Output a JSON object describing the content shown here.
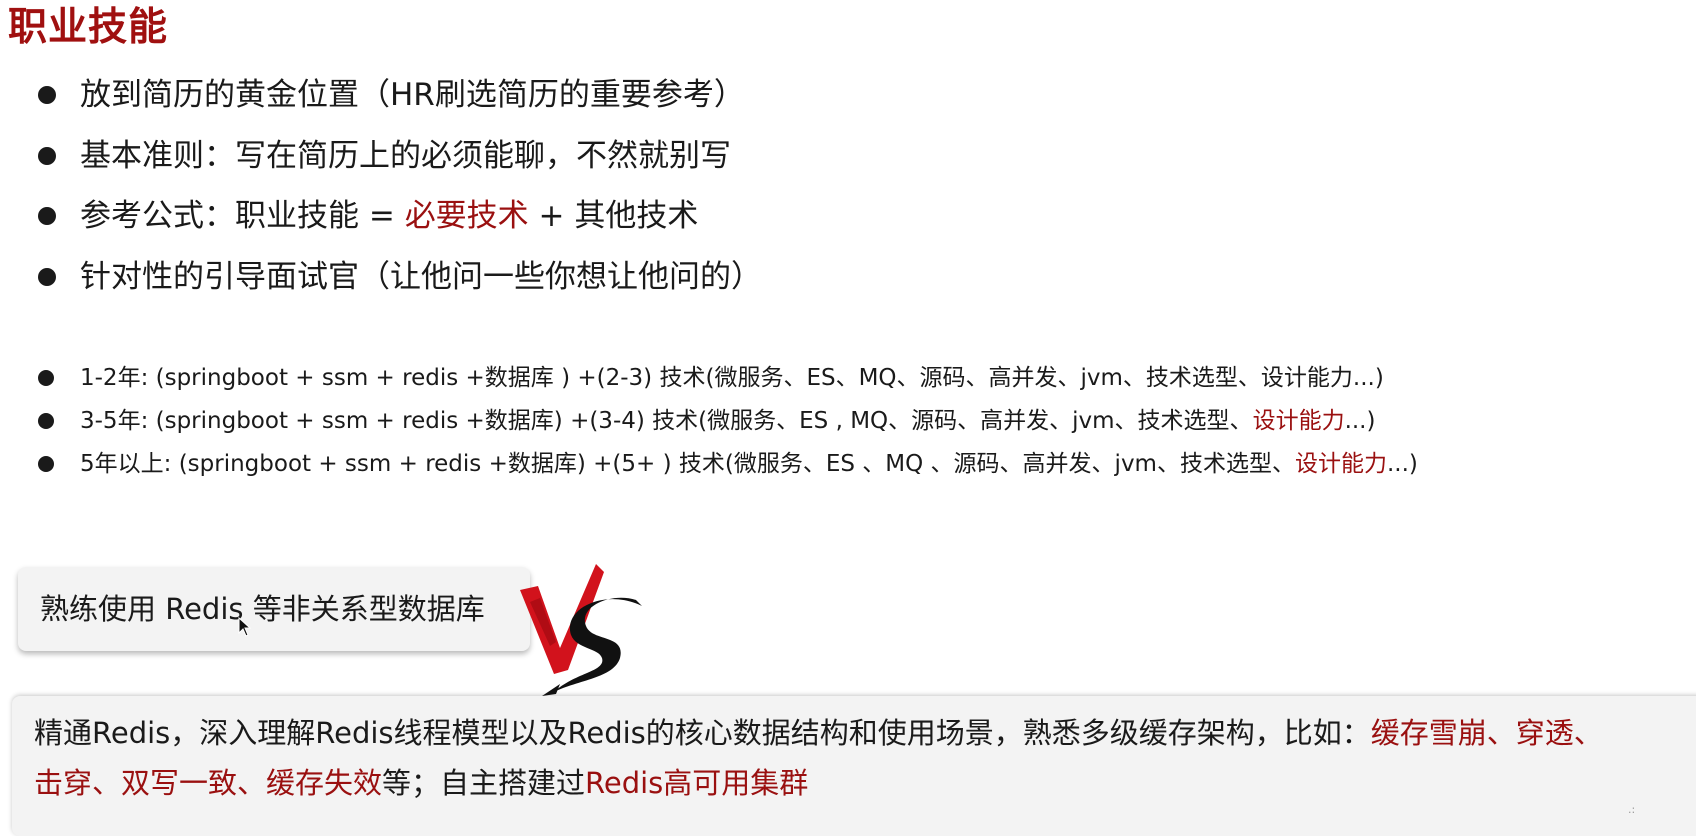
{
  "title": "职业技能",
  "bullets": [
    {
      "text": "放到简历的黄金位置（HR刷选简历的重要参考）"
    },
    {
      "text": "基本准则：写在简历上的必须能聊，不然就别写"
    },
    {
      "pre": "参考公式：职业技能 = ",
      "red": "必要技术",
      "post": " + 其他技术"
    },
    {
      "text": "针对性的引导面试官（让他问一些你想让他问的）"
    }
  ],
  "levels": [
    {
      "pre": "1-2年: (springboot + ssm + redis +数据库 ) +(2-3) 技术(微服务、ES、MQ、源码、高并发、jvm、技术选型、设计能力...)"
    },
    {
      "pre": "3-5年: (springboot + ssm + redis +数据库) +(3-4) 技术(微服务、ES , MQ、源码、高并发、jvm、技术选型、",
      "red": "设计能力",
      "post": "...)"
    },
    {
      "pre": "5年以上: (springboot + ssm + redis +数据库) +(5+ ) 技术(微服务、ES 、MQ 、源码、高并发、jvm、技术选型、",
      "red": "设计能力",
      "post": "...)"
    }
  ],
  "compare": {
    "simple": "熟练使用 Redis 等非关系型数据库",
    "detailed": {
      "line1_pre": "精通Redis，深入理解Redis线程模型以及Redis的核心数据结构和使用场景，熟悉多级缓存架构，比如：",
      "line1_red": "缓存雪崩、穿透、",
      "line2_red": "击穿、双写一致、缓存失效",
      "line2_mid": "等；自主搭建过",
      "line2_red2": "Redis高可用集群"
    }
  },
  "colors": {
    "accent": "#9a1010",
    "title": "#a01010",
    "panel": "#f3f3f3"
  },
  "icons": {
    "vs": "vs-logo",
    "cursor": "mouse-cursor-icon"
  }
}
